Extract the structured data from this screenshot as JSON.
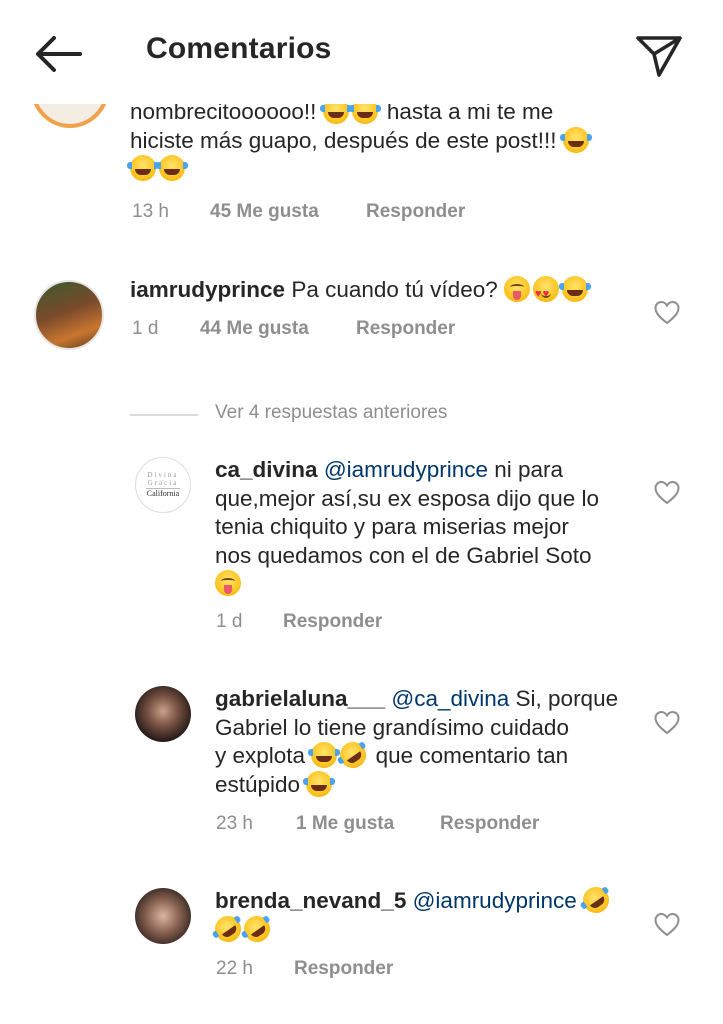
{
  "header": {
    "title": "Comentarios"
  },
  "comments": [
    {
      "text_lines": [
        "nombrecitoooooo!! ",
        "hasta a mi te me",
        "hiciste más guapo, después de este post!!! "
      ],
      "time": "13 h",
      "likes": "45 Me gusta",
      "reply_label": "Responder"
    },
    {
      "username": "iamrudyprince",
      "text": "Pa cuando tú vídeo?",
      "emojis": [
        "drooling-face",
        "heart-eyes-face",
        "tears-of-joy-face"
      ],
      "time": "1 d",
      "likes": "44 Me gusta",
      "reply_label": "Responder"
    }
  ],
  "view_replies": "Ver 4 respuestas anteriores",
  "replies": [
    {
      "username": "ca_divina",
      "mention": "@iamrudyprince",
      "text_lines": [
        "ni para",
        "que,mejor así,su ex esposa dijo que lo",
        "tenia chiquito y para miserias mejor",
        "nos quedamos con el de Gabriel Soto"
      ],
      "avatar_text": [
        "Divina",
        "Gracia",
        "California"
      ],
      "time": "1 d",
      "reply_label": "Responder"
    },
    {
      "username": "gabrielaluna___",
      "mention": "@ca_divina",
      "text_lines": [
        "Si, porque",
        "Gabriel lo tiene grandísimo cuidado",
        "y explota ",
        " que comentario tan",
        "estúpido "
      ],
      "time": "23 h",
      "likes": "1 Me gusta",
      "reply_label": "Responder"
    },
    {
      "username": "brenda_nevand_5",
      "mention": "@iamrudyprince",
      "time": "22 h",
      "reply_label": "Responder"
    }
  ],
  "icons": {
    "back": "arrow-left-icon",
    "send": "paper-plane-icon",
    "like": "heart-outline-icon"
  }
}
